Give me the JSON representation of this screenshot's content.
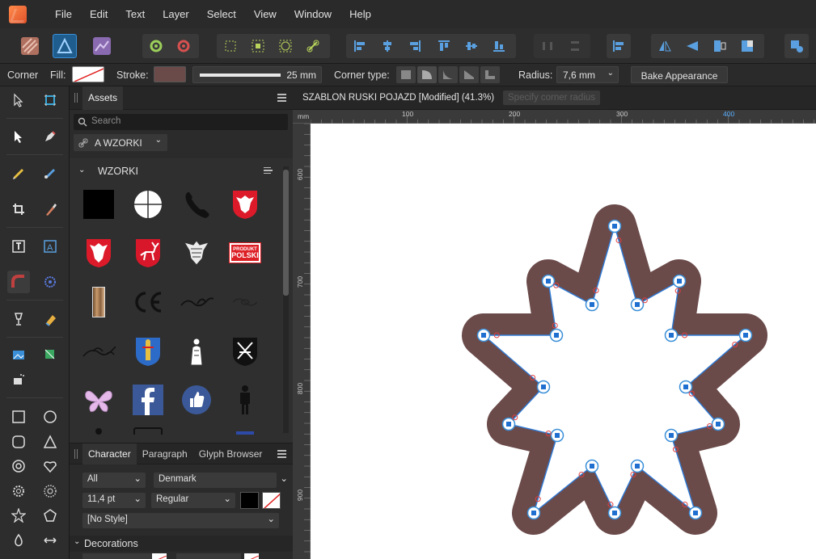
{
  "menu": [
    "File",
    "Edit",
    "Text",
    "Layer",
    "Select",
    "View",
    "Window",
    "Help"
  ],
  "context": {
    "tool_name": "Corner",
    "fill_label": "Fill:",
    "stroke_label": "Stroke:",
    "stroke_width": "25 mm",
    "corner_type_label": "Corner type:",
    "radius_label": "Radius:",
    "radius_value": "7,6 mm",
    "bake_button": "Bake Appearance",
    "stroke_color": "#6b4a4a"
  },
  "assets": {
    "tab": "Assets",
    "search_placeholder": "Search",
    "dropdown": "A WZORKI",
    "category": "WZORKI",
    "items": [
      "black-square",
      "crosshair-circle",
      "telephone",
      "polish-eagle-shield",
      "polish-eagle-shield-2",
      "deer-shield",
      "eagle-emblem",
      "produkt-polski-badge",
      "wood-strip",
      "ce-mark",
      "flourish",
      "ornament",
      "flourish-2",
      "coat-of-arms-saint",
      "saint-figure",
      "emblem-crossed",
      "butterfly",
      "facebook-logo",
      "thumbs-up-icon",
      "person-figure"
    ],
    "produkt_top": "PRODUKT",
    "produkt_bottom": "POLSKI"
  },
  "character": {
    "tabs": [
      "Character",
      "Paragraph",
      "Glyph Browser"
    ],
    "scope": "All",
    "language": "Denmark",
    "size": "11,4 pt",
    "weight": "Regular",
    "style": "[No Style]",
    "decorations": "Decorations"
  },
  "document": {
    "title": "SZABLON RUSKI POJAZD [Modified] (41.3%)",
    "tooltip": "Specify corner radius",
    "ruler_unit": "mm",
    "top_ticks": [
      "100",
      "200",
      "300",
      "400"
    ],
    "left_ticks": [
      "600",
      "700",
      "800",
      "900"
    ]
  },
  "colors": {
    "accent": "#3a8fd8",
    "shape_stroke": "#6b4a4a",
    "path": "#2f7bd6"
  }
}
